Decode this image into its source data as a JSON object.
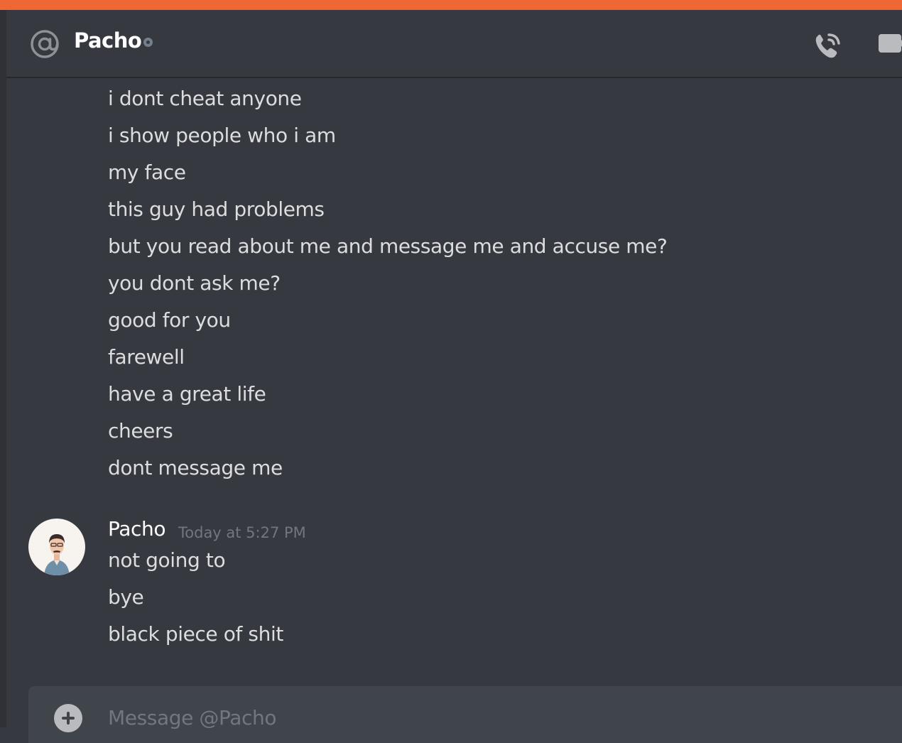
{
  "header": {
    "title": "Pacho",
    "status": "offline",
    "icons": [
      "at-sign-icon",
      "voice-call-icon",
      "video-call-icon"
    ]
  },
  "messages": {
    "previous_lines": [
      "i dont cheat anyone",
      "i show people who i am",
      "my face",
      "this guy had problems",
      "but you read about me and message me and accuse me?",
      "you dont ask me?",
      "good for you",
      "farewell",
      "have a great life",
      "cheers",
      "dont message me"
    ],
    "group": {
      "author": "Pacho",
      "timestamp": "Today at 5:27 PM",
      "lines": [
        "not going to",
        "bye",
        "black piece of shit"
      ]
    }
  },
  "composer": {
    "placeholder": "Message @Pacho",
    "value": ""
  },
  "colors": {
    "accent_bar": "#ee6735",
    "background": "#36393f",
    "header_text": "#ffffff",
    "message_text": "#dcddde",
    "muted_text": "#72767d"
  }
}
